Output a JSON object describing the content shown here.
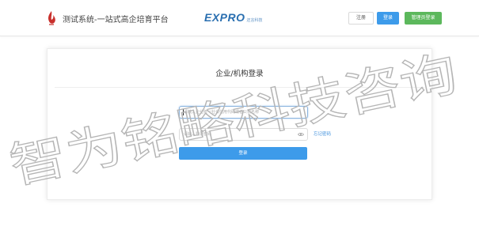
{
  "header": {
    "site_title": "测试系统-一站式高企培育平台",
    "partner_logo_text": "EXPRO",
    "partner_logo_sub": "还言科技",
    "register_label": "注册",
    "login_label": "登录",
    "admin_login_label": "管理员登录"
  },
  "login_card": {
    "title": "企业/机构登录",
    "account_placeholder": "请输入企业统一社会信用代码或者公司名称",
    "password_placeholder": "请输入登录密码",
    "forgot_password_label": "忘记密码",
    "submit_label": "登录"
  },
  "watermark": {
    "text": "智为铭略科技咨询",
    "color": "#b5b5b5"
  },
  "colors": {
    "primary_blue": "#3d9bea",
    "admin_green": "#5cb85c",
    "logo_red": "#c9302c",
    "expro_blue": "#2a6fb0"
  }
}
